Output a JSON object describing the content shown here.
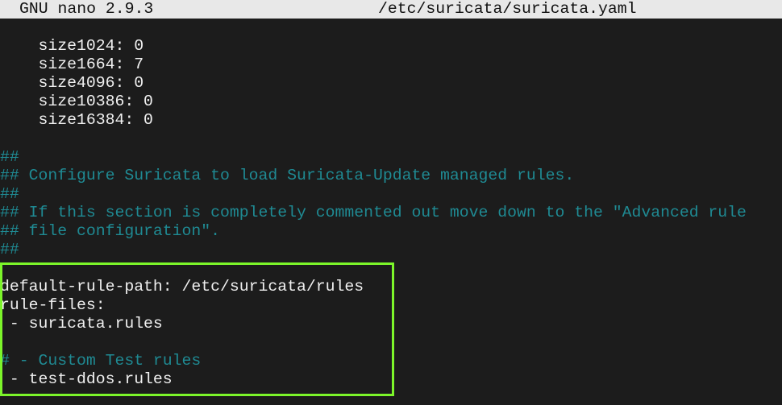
{
  "titlebar": {
    "app": "GNU nano 2.9.3",
    "file": "/etc/suricata/suricata.yaml"
  },
  "colors": {
    "background": "#1c1c1c",
    "text": "#f0f0f0",
    "comment": "#1f8a93",
    "titlebar_bg": "#e8e8e8",
    "highlight": "#7cf52a"
  },
  "lines": [
    {
      "text": "    size1024: 0",
      "type": "code"
    },
    {
      "text": "    size1664: 7",
      "type": "code"
    },
    {
      "text": "    size4096: 0",
      "type": "code"
    },
    {
      "text": "    size10386: 0",
      "type": "code"
    },
    {
      "text": "    size16384: 0",
      "type": "code"
    },
    {
      "text": "",
      "type": "code"
    },
    {
      "text": "##",
      "type": "comment"
    },
    {
      "text": "## Configure Suricata to load Suricata-Update managed rules.",
      "type": "comment"
    },
    {
      "text": "##",
      "type": "comment"
    },
    {
      "text": "## If this section is completely commented out move down to the \"Advanced rule",
      "type": "comment"
    },
    {
      "text": "## file configuration\".",
      "type": "comment"
    },
    {
      "text": "##",
      "type": "comment"
    },
    {
      "text": "",
      "type": "code"
    },
    {
      "text": "default-rule-path: /etc/suricata/rules",
      "type": "code"
    },
    {
      "text": "rule-files:",
      "type": "code"
    },
    {
      "text": " - suricata.rules",
      "type": "code"
    },
    {
      "text": "",
      "type": "code"
    },
    {
      "text": "# - Custom Test rules",
      "type": "comment"
    },
    {
      "text": " - test-ddos.rules",
      "type": "code"
    }
  ]
}
